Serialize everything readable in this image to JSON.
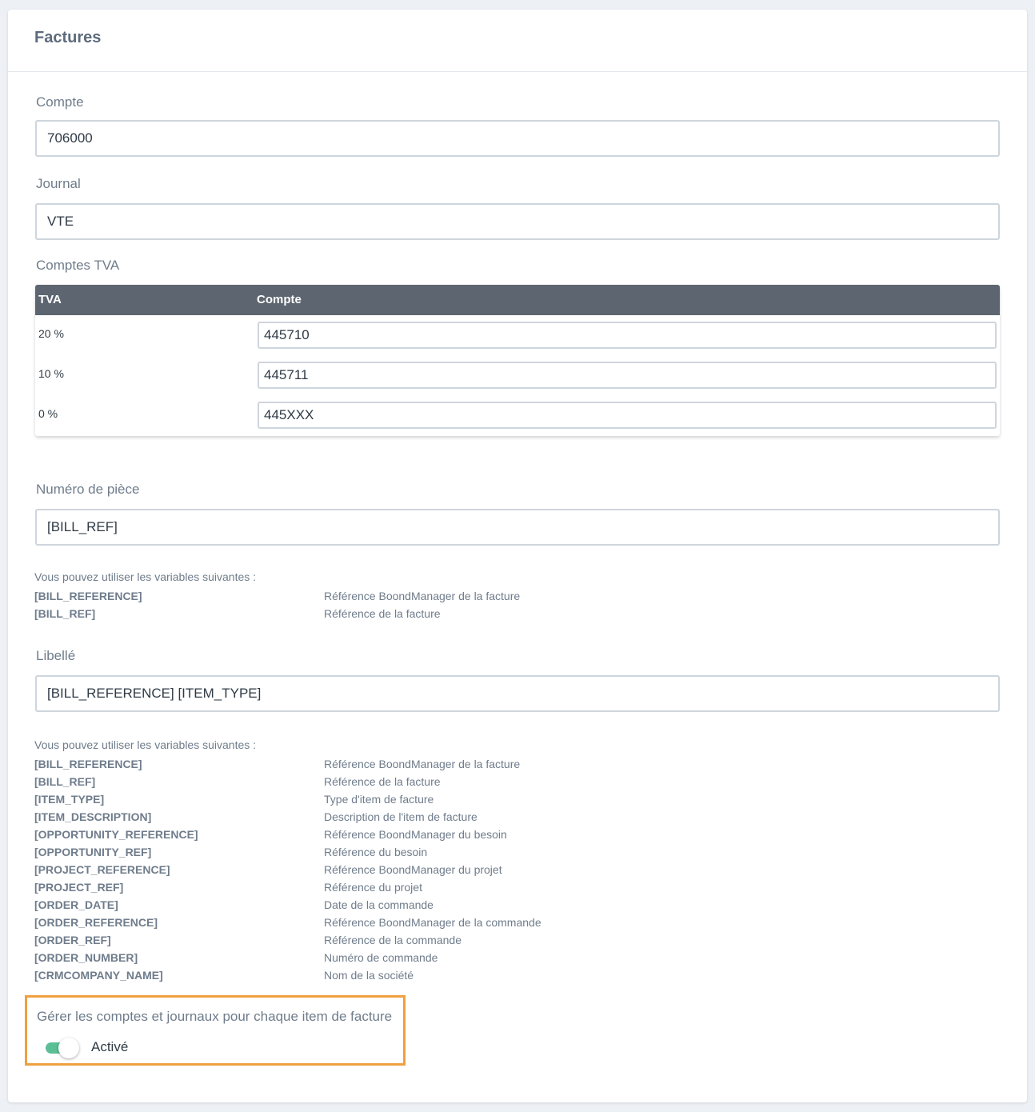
{
  "card": {
    "title": "Factures"
  },
  "fields": {
    "compte": {
      "label": "Compte",
      "value": "706000"
    },
    "journal": {
      "label": "Journal",
      "value": "VTE"
    },
    "comptes_tva": {
      "label": "Comptes TVA"
    },
    "numero_piece": {
      "label": "Numéro de pièce",
      "value": "[BILL_REF]"
    },
    "libelle": {
      "label": "Libellé",
      "value": "[BILL_REFERENCE] [ITEM_TYPE]"
    }
  },
  "tva_table": {
    "headers": [
      "TVA",
      "Compte"
    ],
    "rows": [
      {
        "rate": "20 %",
        "account": "445710"
      },
      {
        "rate": "10 %",
        "account": "445711"
      },
      {
        "rate": "0 %",
        "account": "445XXX"
      }
    ]
  },
  "piece_variables": {
    "intro": "Vous pouvez utiliser les variables suivantes :",
    "items": [
      {
        "name": "[BILL_REFERENCE]",
        "desc": "Référence BoondManager de la facture"
      },
      {
        "name": "[BILL_REF]",
        "desc": "Référence de la facture"
      }
    ]
  },
  "libelle_variables": {
    "intro": "Vous pouvez utiliser les variables suivantes :",
    "items": [
      {
        "name": "[BILL_REFERENCE]",
        "desc": "Référence BoondManager de la facture"
      },
      {
        "name": "[BILL_REF]",
        "desc": "Référence de la facture"
      },
      {
        "name": "[ITEM_TYPE]",
        "desc": "Type d'item de facture"
      },
      {
        "name": "[ITEM_DESCRIPTION]",
        "desc": "Description de l'item de facture"
      },
      {
        "name": "[OPPORTUNITY_REFERENCE]",
        "desc": "Référence BoondManager du besoin"
      },
      {
        "name": "[OPPORTUNITY_REF]",
        "desc": "Référence du besoin"
      },
      {
        "name": "[PROJECT_REFERENCE]",
        "desc": "Référence BoondManager du projet"
      },
      {
        "name": "[PROJECT_REF]",
        "desc": "Référence du projet"
      },
      {
        "name": "[ORDER_DATE]",
        "desc": "Date de la commande"
      },
      {
        "name": "[ORDER_REFERENCE]",
        "desc": "Référence BoondManager de la commande"
      },
      {
        "name": "[ORDER_REF]",
        "desc": "Référence de la commande"
      },
      {
        "name": "[ORDER_NUMBER]",
        "desc": "Numéro de commande"
      },
      {
        "name": "[CRMCOMPANY_NAME]",
        "desc": "Nom de la société"
      }
    ]
  },
  "per_item_toggle": {
    "label": "Gérer les comptes et journaux pour chaque item de facture",
    "state_label": "Activé",
    "enabled": true,
    "highlight_color": "#f0a040",
    "on_color": "#5bbf95"
  }
}
